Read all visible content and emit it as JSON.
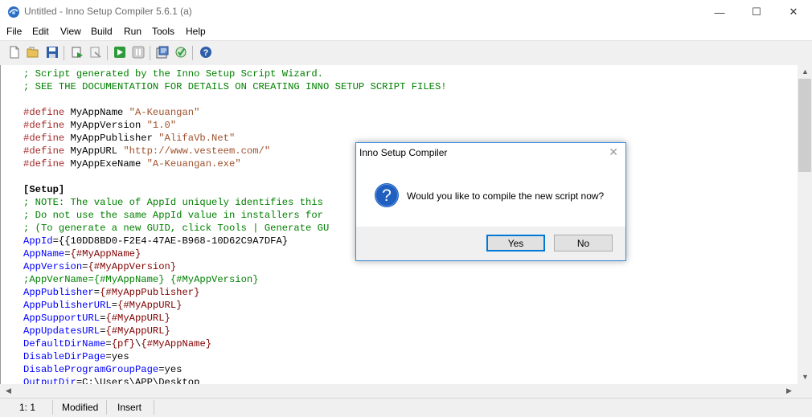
{
  "window": {
    "title": "Untitled - Inno Setup Compiler 5.6.1 (a)",
    "minimize_glyph": "—",
    "maximize_glyph": "☐",
    "close_glyph": "✕"
  },
  "menu": [
    "File",
    "Edit",
    "View",
    "Build",
    "Run",
    "Tools",
    "Help"
  ],
  "toolbar": {
    "icons": [
      "new-file-icon",
      "open-folder-icon",
      "save-icon",
      "compile-icon",
      "stop-compile-icon",
      "run-icon",
      "pause-icon",
      "target-setup-icon",
      "target-uninstall-icon",
      "help-icon"
    ]
  },
  "editor": {
    "lines": [
      [
        {
          "t": "; Script generated by the Inno Setup Script Wizard.",
          "c": "comment"
        }
      ],
      [
        {
          "t": "; SEE THE DOCUMENTATION FOR DETAILS ON CREATING INNO SETUP SCRIPT FILES!",
          "c": "comment"
        }
      ],
      [],
      [
        {
          "t": "#define",
          "c": "def"
        },
        {
          "t": " MyAppName ",
          "c": ""
        },
        {
          "t": "\"A-Keuangan\"",
          "c": "str"
        }
      ],
      [
        {
          "t": "#define",
          "c": "def"
        },
        {
          "t": " MyAppVersion ",
          "c": ""
        },
        {
          "t": "\"1.0\"",
          "c": "str"
        }
      ],
      [
        {
          "t": "#define",
          "c": "def"
        },
        {
          "t": " MyAppPublisher ",
          "c": ""
        },
        {
          "t": "\"AlifaVb.Net\"",
          "c": "str"
        }
      ],
      [
        {
          "t": "#define",
          "c": "def"
        },
        {
          "t": " MyAppURL ",
          "c": ""
        },
        {
          "t": "\"http://www.vesteem.com/\"",
          "c": "str"
        }
      ],
      [
        {
          "t": "#define",
          "c": "def"
        },
        {
          "t": " MyAppExeName ",
          "c": ""
        },
        {
          "t": "\"A-Keuangan.exe\"",
          "c": "str"
        }
      ],
      [],
      [
        {
          "t": "[Setup]",
          "c": "sect"
        }
      ],
      [
        {
          "t": "; NOTE: The value of AppId uniquely identifies this",
          "c": "comment"
        }
      ],
      [
        {
          "t": "; Do not use the same AppId value in installers for",
          "c": "comment"
        }
      ],
      [
        {
          "t": "; (To generate a new GUID, click Tools | Generate GU",
          "c": "comment"
        }
      ],
      [
        {
          "t": "AppId",
          "c": "key"
        },
        {
          "t": "={{10DD8BD0-F2E4-47AE-B968-10D62C9A7DFA}",
          "c": ""
        }
      ],
      [
        {
          "t": "AppName",
          "c": "key"
        },
        {
          "t": "=",
          "c": ""
        },
        {
          "t": "{#MyAppName}",
          "c": "const"
        }
      ],
      [
        {
          "t": "AppVersion",
          "c": "key"
        },
        {
          "t": "=",
          "c": ""
        },
        {
          "t": "{#MyAppVersion}",
          "c": "const"
        }
      ],
      [
        {
          "t": ";AppVerName={#MyAppName} {#MyAppVersion}",
          "c": "comment"
        }
      ],
      [
        {
          "t": "AppPublisher",
          "c": "key"
        },
        {
          "t": "=",
          "c": ""
        },
        {
          "t": "{#MyAppPublisher}",
          "c": "const"
        }
      ],
      [
        {
          "t": "AppPublisherURL",
          "c": "key"
        },
        {
          "t": "=",
          "c": ""
        },
        {
          "t": "{#MyAppURL}",
          "c": "const"
        }
      ],
      [
        {
          "t": "AppSupportURL",
          "c": "key"
        },
        {
          "t": "=",
          "c": ""
        },
        {
          "t": "{#MyAppURL}",
          "c": "const"
        }
      ],
      [
        {
          "t": "AppUpdatesURL",
          "c": "key"
        },
        {
          "t": "=",
          "c": ""
        },
        {
          "t": "{#MyAppURL}",
          "c": "const"
        }
      ],
      [
        {
          "t": "DefaultDirName",
          "c": "key"
        },
        {
          "t": "=",
          "c": ""
        },
        {
          "t": "{pf}",
          "c": "const"
        },
        {
          "t": "\\",
          "c": ""
        },
        {
          "t": "{#MyAppName}",
          "c": "const"
        }
      ],
      [
        {
          "t": "DisableDirPage",
          "c": "key"
        },
        {
          "t": "=yes",
          "c": ""
        }
      ],
      [
        {
          "t": "DisableProgramGroupPage",
          "c": "key"
        },
        {
          "t": "=yes",
          "c": ""
        }
      ],
      [
        {
          "t": "OutputDir",
          "c": "key"
        },
        {
          "t": "=C:\\Users\\APP\\Desktop",
          "c": ""
        }
      ]
    ]
  },
  "statusbar": {
    "position": "1:   1",
    "modified": "Modified",
    "insert_mode": "Insert"
  },
  "dialog": {
    "title": "Inno Setup Compiler",
    "close_glyph": "✕",
    "message": "Would you like to compile the new script now?",
    "yes_label": "Yes",
    "no_label": "No",
    "icon": "question-icon"
  },
  "colors": {
    "comment": "#008000",
    "define": "#a52a2a",
    "key": "#0000ff",
    "string": "#a0522d",
    "dialog_border": "#3b8edb",
    "question_icon": "#1f5fbf"
  }
}
